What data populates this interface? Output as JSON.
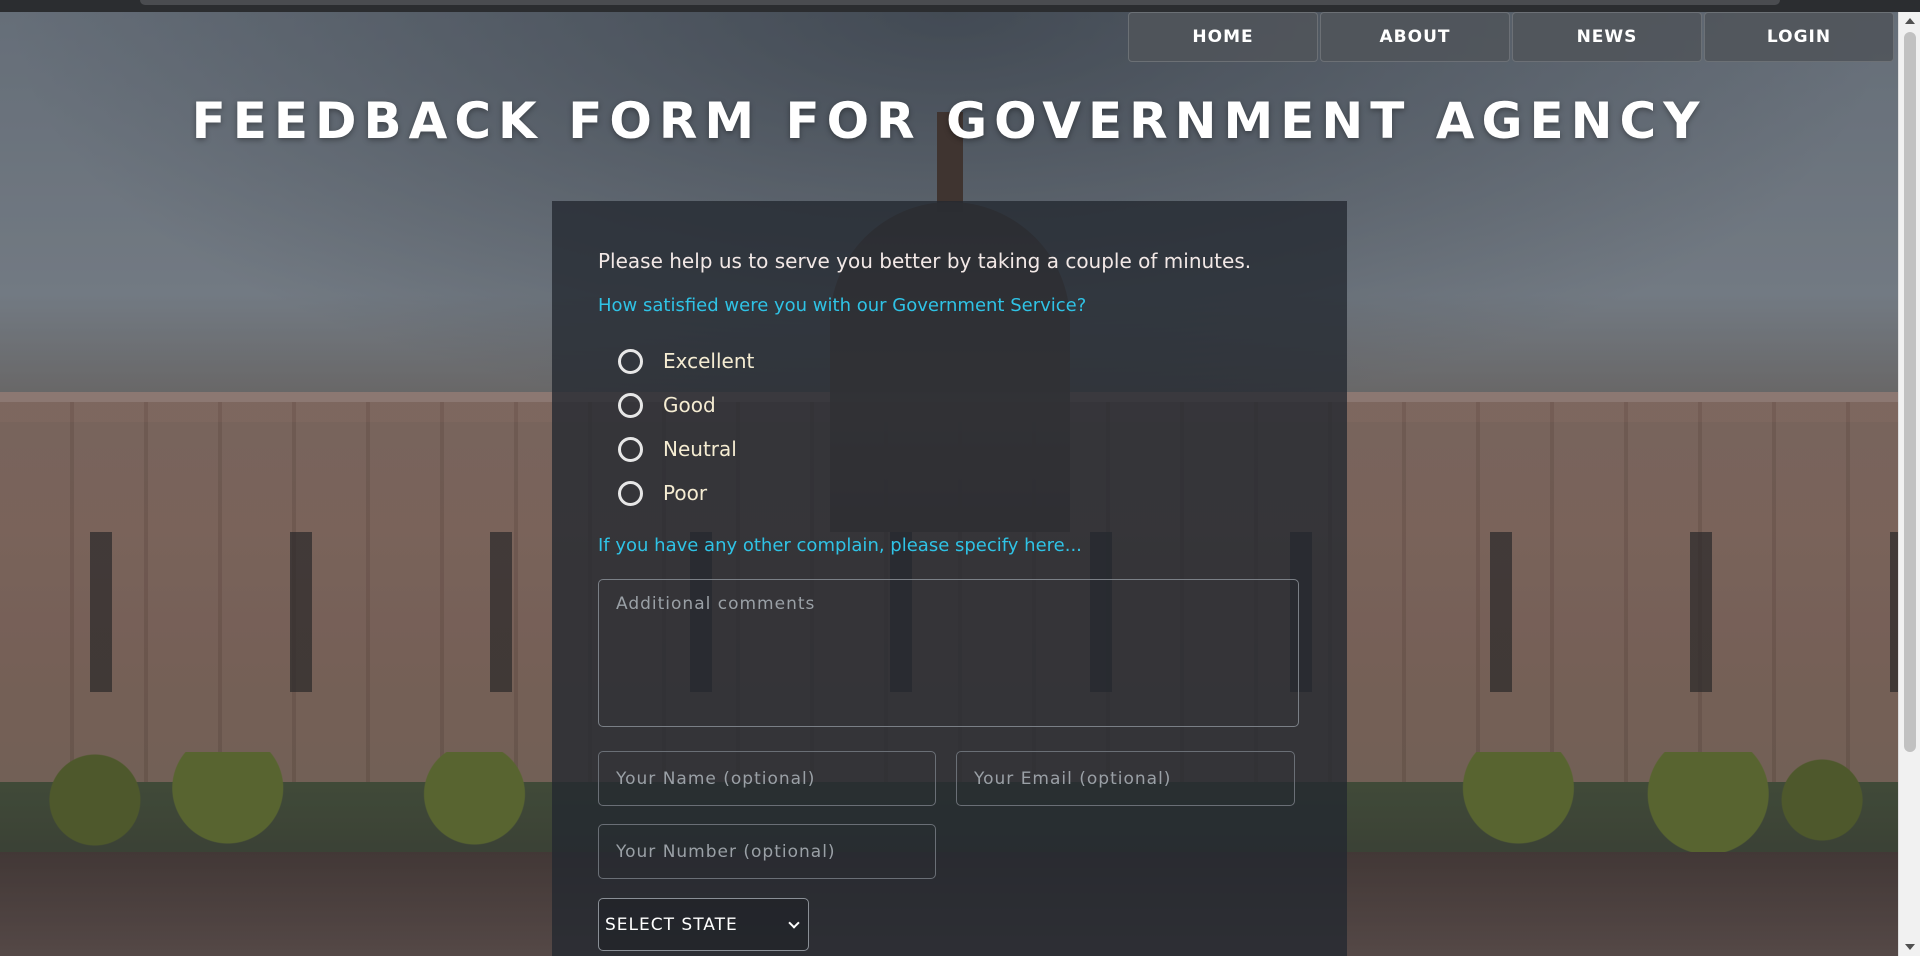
{
  "nav": {
    "items": [
      {
        "label": "HOME"
      },
      {
        "label": "ABOUT"
      },
      {
        "label": "NEWS"
      },
      {
        "label": "LOGIN"
      }
    ]
  },
  "page": {
    "title": "FEEDBACK FORM FOR GOVERNMENT AGENCY"
  },
  "form": {
    "intro": "Please help us to serve you better by taking a couple of minutes.",
    "question": "How satisfied were you with our Government Service?",
    "options": [
      "Excellent",
      "Good",
      "Neutral",
      "Poor"
    ],
    "complain_label": "If you have any other complain, please specify here...",
    "comments_placeholder": "Additional comments",
    "name_placeholder": "Your Name (optional)",
    "email_placeholder": "Your Email (optional)",
    "number_placeholder": "Your Number (optional)",
    "state_select": "SELECT STATE"
  },
  "icons": {
    "radio": "radio-button-icon",
    "select_chevron": "chevron-down-icon"
  },
  "colors": {
    "accent": "#2fc3e6",
    "panel": "#222830",
    "nav_button": "#50545a"
  }
}
